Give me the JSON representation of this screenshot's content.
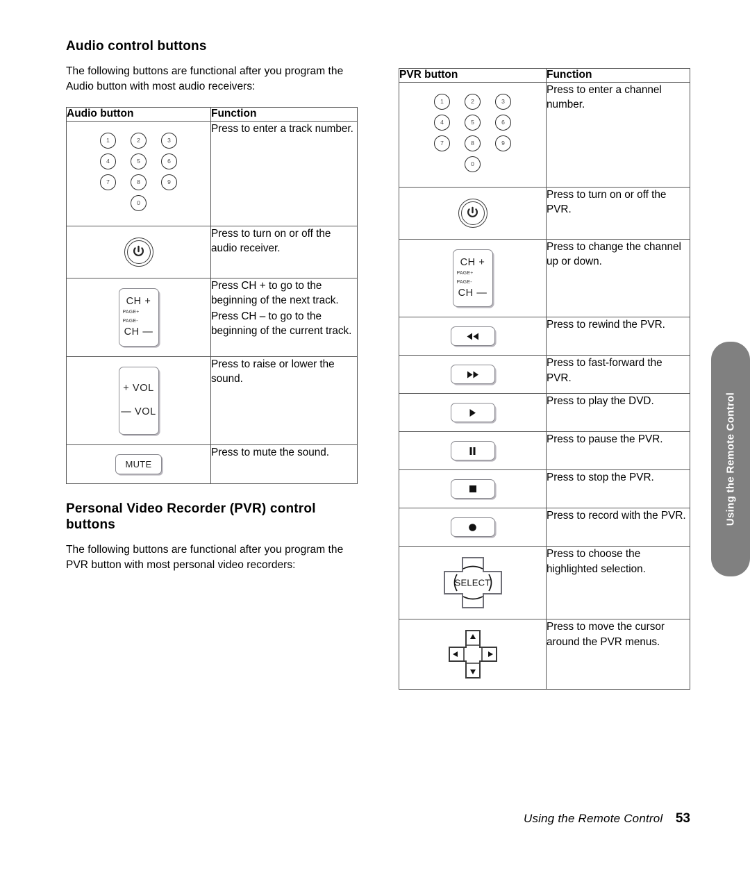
{
  "left": {
    "heading": "Audio control buttons",
    "intro": "The following buttons are functional after you program the Audio button with most audio receivers:",
    "table": {
      "headers": {
        "button": "Audio button",
        "function": "Function"
      },
      "rows": [
        {
          "icon": "numeric-keypad",
          "function_lines": [
            "Press to enter a track number."
          ]
        },
        {
          "icon": "power-button",
          "function_lines": [
            "Press to turn on or off the audio receiver."
          ]
        },
        {
          "icon": "channel-rocker",
          "function_lines": [
            "Press CH + to go to the beginning of the next track.",
            "Press CH – to go to the beginning of the current track."
          ]
        },
        {
          "icon": "volume-rocker",
          "function_lines": [
            "Press to raise or lower the sound."
          ]
        },
        {
          "icon": "mute-button",
          "function_lines": [
            "Press to mute the sound."
          ]
        }
      ]
    },
    "heading2": "Personal Video Recorder (PVR) control buttons",
    "intro2": "The following buttons are functional after you program the PVR button with most personal video recorders:"
  },
  "right": {
    "table": {
      "headers": {
        "button": "PVR button",
        "function": "Function"
      },
      "rows": [
        {
          "icon": "numeric-keypad",
          "function_lines": [
            "Press to enter a channel number."
          ]
        },
        {
          "icon": "power-button",
          "function_lines": [
            "Press to turn on or off the PVR."
          ]
        },
        {
          "icon": "channel-rocker",
          "function_lines": [
            "Press to change the channel up or down."
          ]
        },
        {
          "icon": "rewind-button",
          "function_lines": [
            "Press to rewind the PVR."
          ]
        },
        {
          "icon": "fast-forward-button",
          "function_lines": [
            "Press to fast-forward the PVR."
          ]
        },
        {
          "icon": "play-button",
          "function_lines": [
            "Press to play the DVD."
          ]
        },
        {
          "icon": "pause-button",
          "function_lines": [
            "Press to pause the PVR."
          ]
        },
        {
          "icon": "stop-button",
          "function_lines": [
            "Press to stop the PVR."
          ]
        },
        {
          "icon": "record-button",
          "function_lines": [
            "Press to record with the PVR."
          ]
        },
        {
          "icon": "select-button",
          "function_lines": [
            "Press to choose the highlighted selection."
          ]
        },
        {
          "icon": "direction-pad",
          "function_lines": [
            "Press to move the cursor around the PVR menus."
          ]
        }
      ]
    }
  },
  "keypad": {
    "rows": [
      [
        "1",
        "2",
        "3"
      ],
      [
        "4",
        "5",
        "6"
      ],
      [
        "7",
        "8",
        "9"
      ]
    ],
    "zero": "0"
  },
  "rocker": {
    "ch_up": "CH +",
    "page_up": "PAGE+",
    "page_down": "PAGE-",
    "ch_down": "CH —",
    "vol_up": "+ VOL",
    "vol_down": "— VOL"
  },
  "labels": {
    "mute": "MUTE",
    "select": "SELECT"
  },
  "sidetab": {
    "text": "Using the Remote Control"
  },
  "footer": {
    "text": "Using the Remote Control",
    "page": "53"
  },
  "colors": {
    "tab_bg": "#808080",
    "rule": "#555555",
    "button_outline": "#8a8a90",
    "shadow": "#b9b6bd"
  }
}
